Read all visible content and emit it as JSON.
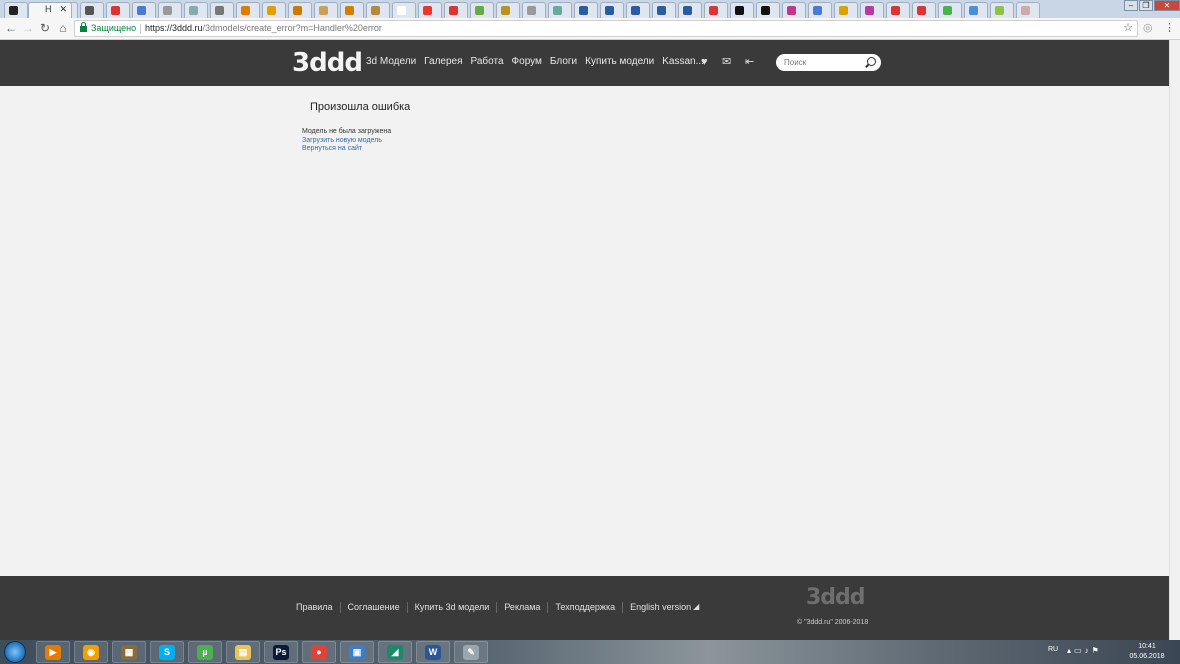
{
  "browser": {
    "active_tab_title": "Н",
    "security_label": "Защищено",
    "url_host": "https://3ddd.ru",
    "url_path": "/3dmodels/create_error?m=Handler%20error"
  },
  "site": {
    "logo": "3ddd",
    "nav": [
      "3d Модели",
      "Галерея",
      "Работа",
      "Форум",
      "Блоги",
      "Купить модели",
      "Kassan..."
    ],
    "search_placeholder": "Поиск"
  },
  "error_page": {
    "title": "Произошла ошибка",
    "message": "Модель не была загружена",
    "link_upload": "Загрузить новую модель",
    "link_back": "Вернуться на сайт"
  },
  "footer": {
    "links": [
      "Правила",
      "Соглашение",
      "Купить 3d модели",
      "Реклама",
      "Техподдержка",
      "English version"
    ],
    "logo": "3ddd",
    "copyright": "© \"3ddd.ru\" 2006-2018"
  },
  "taskbar": {
    "apps": [
      "media-player",
      "orange-app",
      "archive",
      "skype",
      "utorrent",
      "file-explorer",
      "photoshop",
      "chrome",
      "network-app",
      "green-app",
      "word",
      "paint-app"
    ],
    "language": "RU",
    "time": "10:41",
    "date": "05.06.2018"
  },
  "colors": {
    "header_bg": "#3a3a3a",
    "page_bg": "#f2f2f2",
    "link": "#3a6aa0",
    "secure_green": "#0b8043"
  }
}
